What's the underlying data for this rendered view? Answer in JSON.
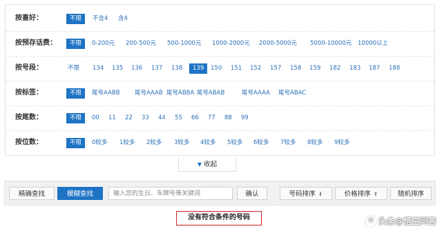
{
  "filters": [
    {
      "label": "按喜好：",
      "options": [
        "不限",
        "不含4",
        "含4"
      ],
      "selected": 0
    },
    {
      "label": "按预存话费：",
      "options": [
        "不限",
        "0-200元",
        "200-500元",
        "500-1000元",
        "1000-2000元",
        "2000-5000元",
        "5000-10000元",
        "10000以上"
      ],
      "selected": 0
    },
    {
      "label": "按号段：",
      "options": [
        "不限",
        "134",
        "135",
        "136",
        "137",
        "138",
        "139",
        "150",
        "151",
        "152",
        "157",
        "158",
        "159",
        "182",
        "183",
        "187",
        "188"
      ],
      "selected": 6
    },
    {
      "label": "按标签：",
      "options": [
        "不限",
        "尾号AABB",
        "尾号AAAB",
        "尾号ABBA",
        "尾号ABAB",
        "尾号AAAA",
        "尾号ABAC"
      ],
      "selected": 0
    },
    {
      "label": "按尾数：",
      "options": [
        "不限",
        "00",
        "11",
        "22",
        "33",
        "44",
        "55",
        "66",
        "77",
        "88",
        "99"
      ],
      "selected": 0
    },
    {
      "label": "按位数：",
      "options": [
        "不限",
        "0较多",
        "1较多",
        "2较多",
        "3较多",
        "4较多",
        "5较多",
        "6较多",
        "7较多",
        "8较多",
        "9较多"
      ],
      "selected": 0
    }
  ],
  "collapse_label": "收起",
  "search": {
    "exact_label": "精确查找",
    "fuzzy_label": "模糊查找",
    "placeholder": "输入您的生日、车牌号等关键词",
    "confirm_label": "确认",
    "sort_number_label": "号码排序",
    "sort_price_label": "价格排序",
    "random_label": "随机排序"
  },
  "no_result_text": "没有符合条件的号码",
  "watermark_text": "头条@悟空问答"
}
